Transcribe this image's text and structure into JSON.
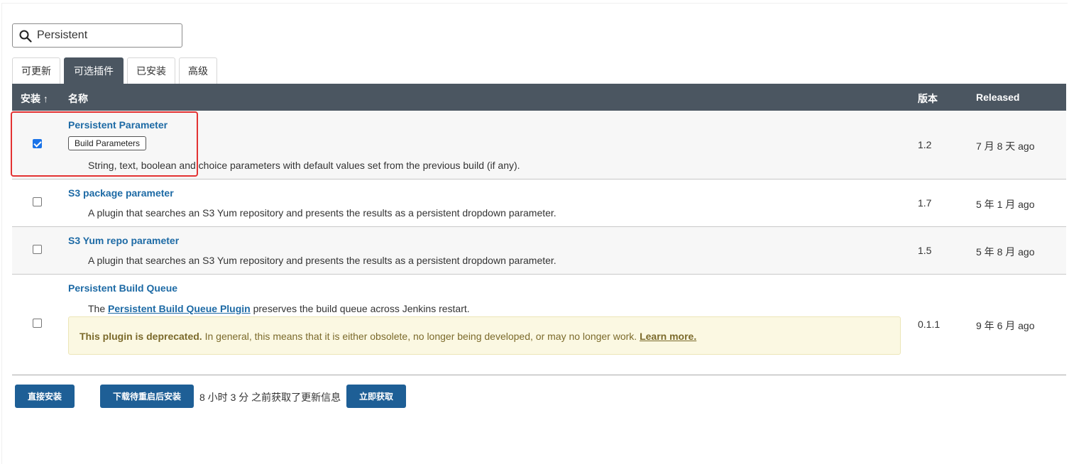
{
  "search": {
    "value": "Persistent"
  },
  "tabs": [
    {
      "label": "可更新",
      "active": false
    },
    {
      "label": "可选插件",
      "active": true
    },
    {
      "label": "已安装",
      "active": false
    },
    {
      "label": "高级",
      "active": false
    }
  ],
  "table": {
    "headers": {
      "install": "安装 ↑",
      "name": "名称",
      "version": "版本",
      "released": "Released"
    },
    "rows": [
      {
        "checked": true,
        "name": "Persistent Parameter",
        "label": "Build Parameters",
        "description": "String, text, boolean and choice parameters with default values set from the previous build (if any).",
        "version": "1.2",
        "released": "7 月 8 天 ago"
      },
      {
        "checked": false,
        "name": "S3 package parameter",
        "description": "A plugin that searches an S3 Yum repository and presents the results as a persistent dropdown parameter.",
        "version": "1.7",
        "released": "5 年 1 月 ago"
      },
      {
        "checked": false,
        "name": "S3 Yum repo parameter",
        "description": "A plugin that searches an S3 Yum repository and presents the results as a persistent dropdown parameter.",
        "version": "1.5",
        "released": "5 年 8 月 ago"
      },
      {
        "checked": false,
        "name": "Persistent Build Queue",
        "description_prefix": "The ",
        "description_link": "Persistent Build Queue Plugin",
        "description_suffix": " preserves the build queue across Jenkins restart.",
        "deprecated_strong": "This plugin is deprecated.",
        "deprecated_text": " In general, this means that it is either obsolete, no longer being developed, or may no longer work. ",
        "deprecated_link": "Learn more.",
        "version": "0.1.1",
        "released": "9 年 6 月 ago"
      }
    ]
  },
  "footer": {
    "install_now": "直接安装",
    "download_restart": "下载待重启后安装",
    "updated_info": "8 小时 3 分 之前获取了更新信息",
    "check_now": "立即获取"
  },
  "colors": {
    "header_bg": "#4b5661",
    "link": "#1d6aa5",
    "button": "#1e5f96",
    "highlight_box": "#e33232",
    "deprecated_bg": "#fbf8e2"
  }
}
